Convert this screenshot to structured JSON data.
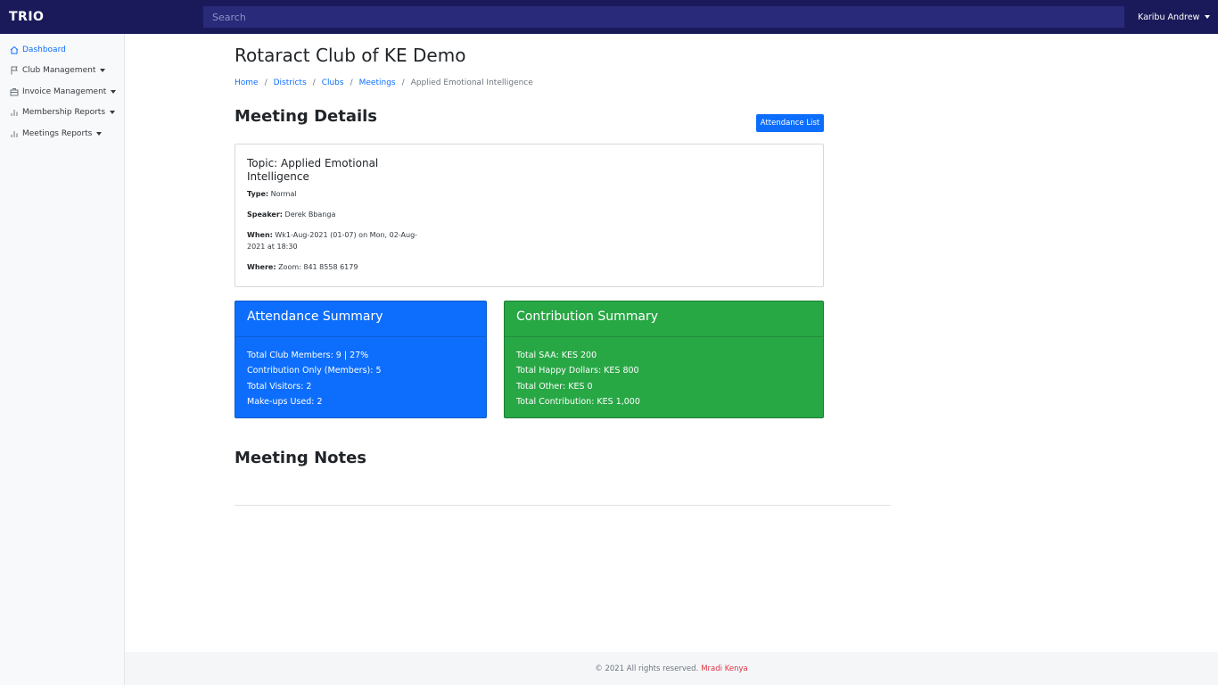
{
  "topbar": {
    "brand": "TRIO",
    "search_placeholder": "Search",
    "user_label": "Karibu Andrew"
  },
  "sidebar": {
    "items": [
      {
        "label": "Dashboard",
        "icon": "home-icon",
        "active": true
      },
      {
        "label": "Club Management",
        "icon": "flag-icon",
        "active": false
      },
      {
        "label": "Invoice Management",
        "icon": "briefcase-icon",
        "active": false
      },
      {
        "label": "Membership Reports",
        "icon": "bar-chart-icon",
        "active": false
      },
      {
        "label": "Meetings Reports",
        "icon": "bar-chart-icon",
        "active": false
      }
    ]
  },
  "page": {
    "club_title": "Rotaract Club of KE Demo",
    "breadcrumb": [
      "Home",
      "Districts",
      "Clubs",
      "Meetings",
      "Applied Emotional Intelligence"
    ],
    "meeting_details_title": "Meeting Details",
    "attendance_list_button": "Attendance List"
  },
  "meeting": {
    "topic": "Topic: Applied Emotional Intelligence",
    "type_label": "Type:",
    "type_value": "Normal",
    "speaker_label": "Speaker:",
    "speaker_value": "Derek Bbanga",
    "when_label": "When:",
    "when_value": "Wk1-Aug-2021 (01-07) on Mon, 02-Aug-2021 at 18:30",
    "where_label": "Where:",
    "where_value": "Zoom: 841 8558 6179"
  },
  "attendance_summary": {
    "title": "Attendance Summary",
    "lines": [
      "Total Club Members: 9 | 27%",
      "Contribution Only (Members): 5",
      "Total Visitors: 2",
      "Make-ups Used: 2"
    ]
  },
  "contribution_summary": {
    "title": "Contribution Summary",
    "lines": [
      "Total SAA: KES 200",
      "Total Happy Dollars: KES 800",
      "Total Other: KES 0",
      "Total Contribution: KES 1,000"
    ]
  },
  "notes": {
    "title": "Meeting Notes"
  },
  "footer": {
    "text": "© 2021 All rights reserved.",
    "link": "Mradi Kenya"
  },
  "colors": {
    "topbar": "#1a1a5a",
    "primary": "#0d6efd",
    "success": "#28a745",
    "footer_link": "#dc3545"
  }
}
